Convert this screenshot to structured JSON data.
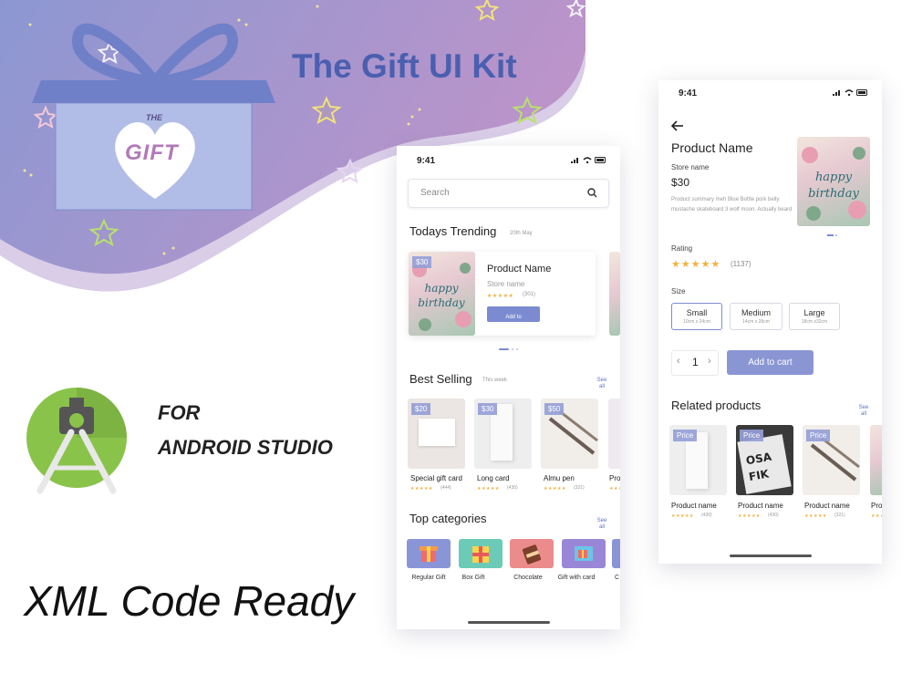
{
  "hero": {
    "title": "The Gift UI Kit",
    "box_small_text": "THE",
    "box_big_text": "GIFT"
  },
  "studio": {
    "line1": "FOR",
    "line2": "ANDROID STUDIO"
  },
  "tagline": "XML Code Ready",
  "colors": {
    "accent": "#7c8bd0",
    "brand_purple": "#a98ecb",
    "title_blue": "#4a5fb0",
    "star": "#f4b13e"
  },
  "phone1": {
    "status_time": "9:41",
    "search_placeholder": "Search",
    "trending": {
      "title": "Todays Trending",
      "date": "20th May",
      "card": {
        "price": "$30",
        "product_name": "Product Name",
        "store": "Store name",
        "stars": "★★★★★",
        "rating_count": "(301)",
        "button": "Add to"
      }
    },
    "best_selling": {
      "title": "Best Selling",
      "subtitle": "This week",
      "see_all": "See all",
      "items": [
        {
          "price": "$20",
          "name": "Special gift card",
          "stars": "★★★★★",
          "count": "(444)"
        },
        {
          "price": "$30",
          "name": "Long card",
          "stars": "★★★★★",
          "count": "(430)"
        },
        {
          "price": "$50",
          "name": "Almu pen",
          "stars": "★★★★★",
          "count": "(321)"
        },
        {
          "price": "",
          "name": "Pro",
          "stars": "★★★★★",
          "count": ""
        }
      ]
    },
    "categories": {
      "title": "Top categories",
      "see_all": "See all",
      "items": [
        {
          "label": "Regular Gift",
          "color": "#8a95d8"
        },
        {
          "label": "Box Gift",
          "color": "#6ccbb7"
        },
        {
          "label": "Chocolate",
          "color": "#ec8b8b"
        },
        {
          "label": "Gift with card",
          "color": "#9a86d6"
        },
        {
          "label": "C",
          "color": "#8a95d8"
        }
      ]
    }
  },
  "phone2": {
    "status_time": "9:41",
    "product_name": "Product Name",
    "store": "Store name",
    "price": "$30",
    "summary": "Product summary meh Blue Bottle pork belly mustache skateboard 3 wolf moon. Actually beard",
    "rating_label": "Rating",
    "stars": "★★★★★",
    "rating_count": "(1137)",
    "size_label": "Size",
    "sizes": [
      {
        "name": "Small",
        "dims": "10cm x 24cm"
      },
      {
        "name": "Medium",
        "dims": "14cm x 28cm"
      },
      {
        "name": "Large",
        "dims": "18cm x32cm"
      }
    ],
    "quantity": "1",
    "add_to_cart": "Add to cart",
    "related": {
      "title": "Related products",
      "see_all": "See all",
      "items": [
        {
          "price": "Price",
          "name": "Product name",
          "stars": "★★★★★",
          "count": "(430)"
        },
        {
          "price": "Price",
          "name": "Product name",
          "stars": "★★★★★",
          "count": "(430)"
        },
        {
          "price": "Price",
          "name": "Product name",
          "stars": "★★★★★",
          "count": "(321)"
        },
        {
          "price": "",
          "name": "Pro",
          "stars": "★★★★★",
          "count": ""
        }
      ]
    }
  }
}
